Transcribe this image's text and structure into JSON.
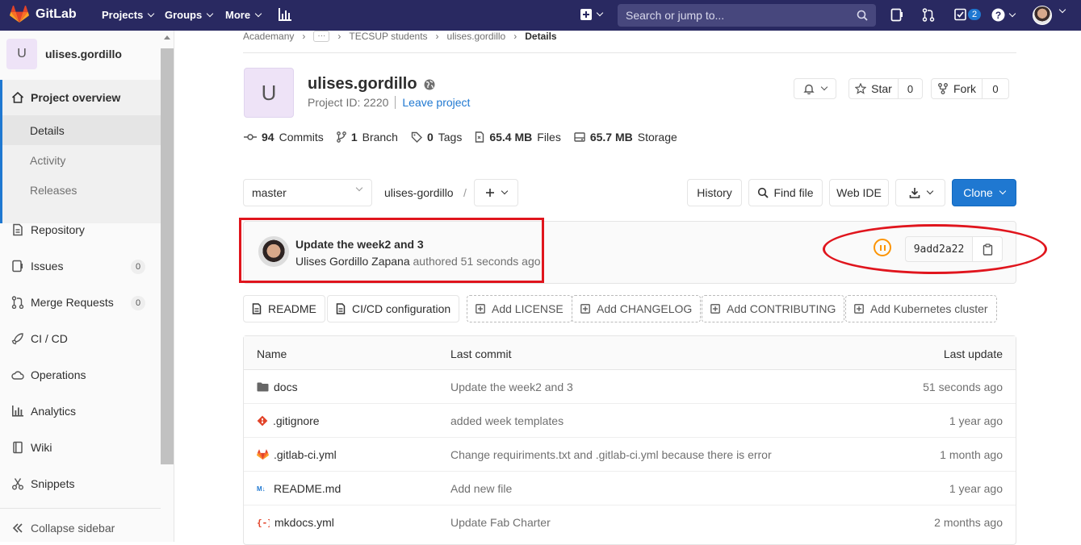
{
  "topbar": {
    "logo_text": "GitLab",
    "nav": [
      {
        "label": "Projects"
      },
      {
        "label": "Groups"
      },
      {
        "label": "More"
      }
    ],
    "search_placeholder": "Search or jump to...",
    "todo_count": "2"
  },
  "sidebar": {
    "project_letter": "U",
    "project_name": "ulises.gordillo",
    "overview": "Project overview",
    "sub": [
      "Details",
      "Activity",
      "Releases"
    ],
    "items": [
      {
        "label": "Repository",
        "icon": "doc-icon"
      },
      {
        "label": "Issues",
        "icon": "issues-icon",
        "count": "0"
      },
      {
        "label": "Merge Requests",
        "icon": "merge-request-icon",
        "count": "0"
      },
      {
        "label": "CI / CD",
        "icon": "rocket-icon"
      },
      {
        "label": "Operations",
        "icon": "cloud-icon"
      },
      {
        "label": "Analytics",
        "icon": "chart-icon"
      },
      {
        "label": "Wiki",
        "icon": "book-icon"
      },
      {
        "label": "Snippets",
        "icon": "scissors-icon"
      }
    ],
    "collapse": "Collapse sidebar"
  },
  "breadcrumb": {
    "items": [
      "Academany",
      "TECSUP students",
      "ulises.gordillo"
    ],
    "current": "Details"
  },
  "project": {
    "letter": "U",
    "name": "ulises.gordillo",
    "id_label": "Project ID: 2220",
    "leave": "Leave project",
    "star_label": "Star",
    "star_count": "0",
    "fork_label": "Fork",
    "fork_count": "0"
  },
  "stats": {
    "commits_num": "94",
    "commits_label": "Commits",
    "branch_num": "1",
    "branch_label": "Branch",
    "tags_num": "0",
    "tags_label": "Tags",
    "files_num": "65.4 MB",
    "files_label": "Files",
    "storage_num": "65.7 MB",
    "storage_label": "Storage"
  },
  "repo": {
    "branch": "master",
    "path": "ulises-gordillo",
    "path_sep": "/",
    "history": "History",
    "find_file": "Find file",
    "web_ide": "Web IDE",
    "clone": "Clone"
  },
  "commit": {
    "title": "Update the week2 and 3",
    "author": "Ulises Gordillo Zapana",
    "authored": "authored 51 seconds ago",
    "sha": "9add2a22",
    "pipeline_status_color": "#fc9403"
  },
  "shortcuts": [
    {
      "label": "README",
      "dashed": false
    },
    {
      "label": "CI/CD configuration",
      "dashed": false
    },
    {
      "label": "Add LICENSE",
      "dashed": true
    },
    {
      "label": "Add CHANGELOG",
      "dashed": true
    },
    {
      "label": "Add CONTRIBUTING",
      "dashed": true
    },
    {
      "label": "Add Kubernetes cluster",
      "dashed": true
    }
  ],
  "table": {
    "headers": {
      "name": "Name",
      "last_commit": "Last commit",
      "last_update": "Last update"
    },
    "rows": [
      {
        "name": "docs",
        "icon": "folder-icon",
        "message": "Update the week2 and 3",
        "updated": "51 seconds ago"
      },
      {
        "name": ".gitignore",
        "icon": "git-icon",
        "message": "added week templates",
        "updated": "1 year ago"
      },
      {
        "name": ".gitlab-ci.yml",
        "icon": "gitlab-icon",
        "message": "Change requiriments.txt and .gitlab-ci.yml because there is error",
        "updated": "1 month ago"
      },
      {
        "name": "README.md",
        "icon": "markdown-icon",
        "message": "Add new file",
        "updated": "1 year ago"
      },
      {
        "name": "mkdocs.yml",
        "icon": "yaml-icon",
        "message": "Update Fab Charter",
        "updated": "2 months ago"
      }
    ]
  },
  "colors": {
    "accent": "#1f78d1",
    "topbar": "#292961",
    "annotation": "#e0151d"
  }
}
